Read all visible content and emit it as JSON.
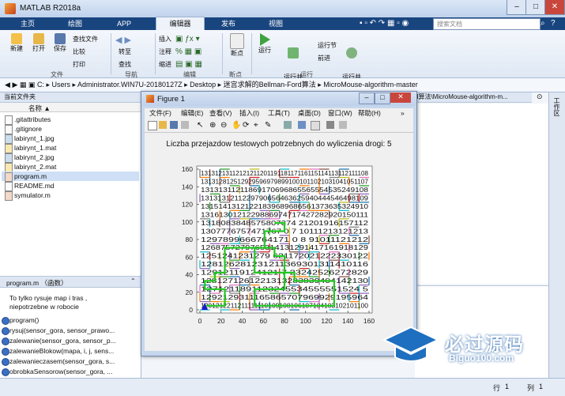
{
  "app": {
    "title": "MATLAB R2018a"
  },
  "tabs": [
    "主页",
    "绘图",
    "APP",
    "编辑器",
    "发布",
    "视图"
  ],
  "search_placeholder": "搜索文档",
  "ribbon": {
    "file": {
      "new": "新建",
      "open": "打开",
      "save": "保存",
      "find_files": "查找文件",
      "compare": "比较",
      "print": "打印",
      "group": "文件"
    },
    "nav": {
      "goto": "转至",
      "find": "查找",
      "group": "导航"
    },
    "edit": {
      "insert": "插入",
      "comment": "注释",
      "indent": "缩进",
      "group": "编辑"
    },
    "breakpoints": {
      "label": "断点",
      "group": "断点"
    },
    "run": {
      "run": "运行",
      "run_advance": "运行并\n前进",
      "run_section": "运行节",
      "advance": "前进",
      "run_time": "运行并\n计时",
      "group": "运行"
    }
  },
  "path": [
    "C:",
    "Users",
    "Administrator.WIN7U-20180127Z",
    "Desktop",
    "迷宫求解的Bellman-Ford算法",
    "MicroMouse-algorithm-master"
  ],
  "left_panel": {
    "title": "当前文件夹",
    "col_name": "名称 ▲",
    "files": [
      ".gitattributes",
      ".gitignore",
      "labirynt_1.jpg",
      "labirynt_1.mat",
      "labirynt_2.jpg",
      "labirynt_2.mat",
      "program.m",
      "README.md",
      "symulator.m"
    ],
    "detail_title": "program.m （函数）",
    "detail_desc": "To tylko rysuje map  i tras ,\nniepotrzebne w robocie",
    "functions": [
      "program()",
      "rysuj(sensor_gora, sensor_prawo...",
      "zalewanie(sensor_gora, sensor_p...",
      "zalewanieBlokow(mapa, i, j, sens...",
      "zalewanieczasem(sensor_gora, s...",
      "obrobkaSensorow(sensor_gora, ..."
    ]
  },
  "editor_tab_partial": "d算法\\MicroMouse-algorithm-m...",
  "right_dock_label": "工作区",
  "status": {
    "row_label": "行",
    "row": "1",
    "col_label": "列",
    "col": "1"
  },
  "figure": {
    "title": "Figure 1",
    "menu": [
      "文件(F)",
      "编辑(E)",
      "查看(V)",
      "插入(I)",
      "工具(T)",
      "桌面(D)",
      "窗口(W)",
      "帮助(H)"
    ],
    "plot_title": "Liczba przejazdow testowych potrzebnych do wyliczenia drogi: 5",
    "xticks": [
      "0",
      "20",
      "40",
      "60",
      "80",
      "100",
      "120",
      "140",
      "160"
    ],
    "yticks": [
      "0",
      "20",
      "40",
      "60",
      "80",
      "100",
      "120",
      "140",
      "160"
    ],
    "rows": [
      "1313121311212121120119118117116115114113112111108",
      "1313128125129295969798991001011021031041051107",
      "13131311211869170696865565554535249108",
      "1313131211229790656463625940444546498109",
      "13151413121221839689686561373635324910",
      "1316130121229886974717427282920150111",
      "1318083848575807374 21201916157112",
      "1307776757471767 0 7 10111213121213",
      "1297899666764171 0 8 91011121212",
      "1268757279765314131291417161918129",
      "1251241231279 621172021222330122",
      "128126281231211369301311410116",
      "12912119124121 7 23242526272829",
      "1281271261221313283839404142130",
      "1271211891123245534555551524 5",
      "1292129311165865707969929195964",
      "1201212211211111110109108106107104103102101100"
    ]
  },
  "watermark": {
    "title": "必过源码",
    "sub": "Biguo100.com"
  }
}
